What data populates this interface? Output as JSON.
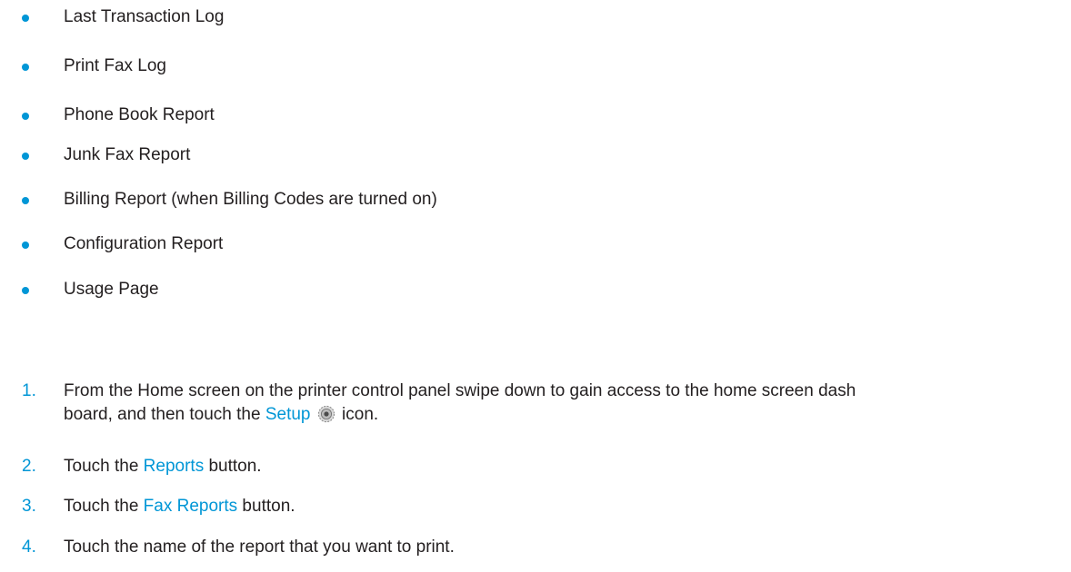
{
  "report_list": [
    "Last Transaction Log",
    "Print Fax Log",
    "Phone Book Report",
    "Junk Fax Report",
    "Billing Report (when Billing Codes are turned on)",
    "Configuration Report",
    "Usage Page"
  ],
  "steps": [
    {
      "number": "1.",
      "line1": "From the Home screen on the printer control panel swipe down to gain access to the home screen dash",
      "line2_prefix": "board, and then touch the ",
      "line2_link": "Setup",
      "line2_icon": "gear-icon",
      "line2_suffix": " icon."
    },
    {
      "number": "2.",
      "prefix": "Touch the ",
      "link": "Reports",
      "suffix": " button."
    },
    {
      "number": "3.",
      "prefix": "Touch the ",
      "link": "Fax Reports",
      "suffix": " button."
    },
    {
      "number": "4.",
      "text": "Touch the name of the report that you want to print."
    }
  ],
  "colors": {
    "accent": "#0096d6",
    "text": "#231f20"
  }
}
